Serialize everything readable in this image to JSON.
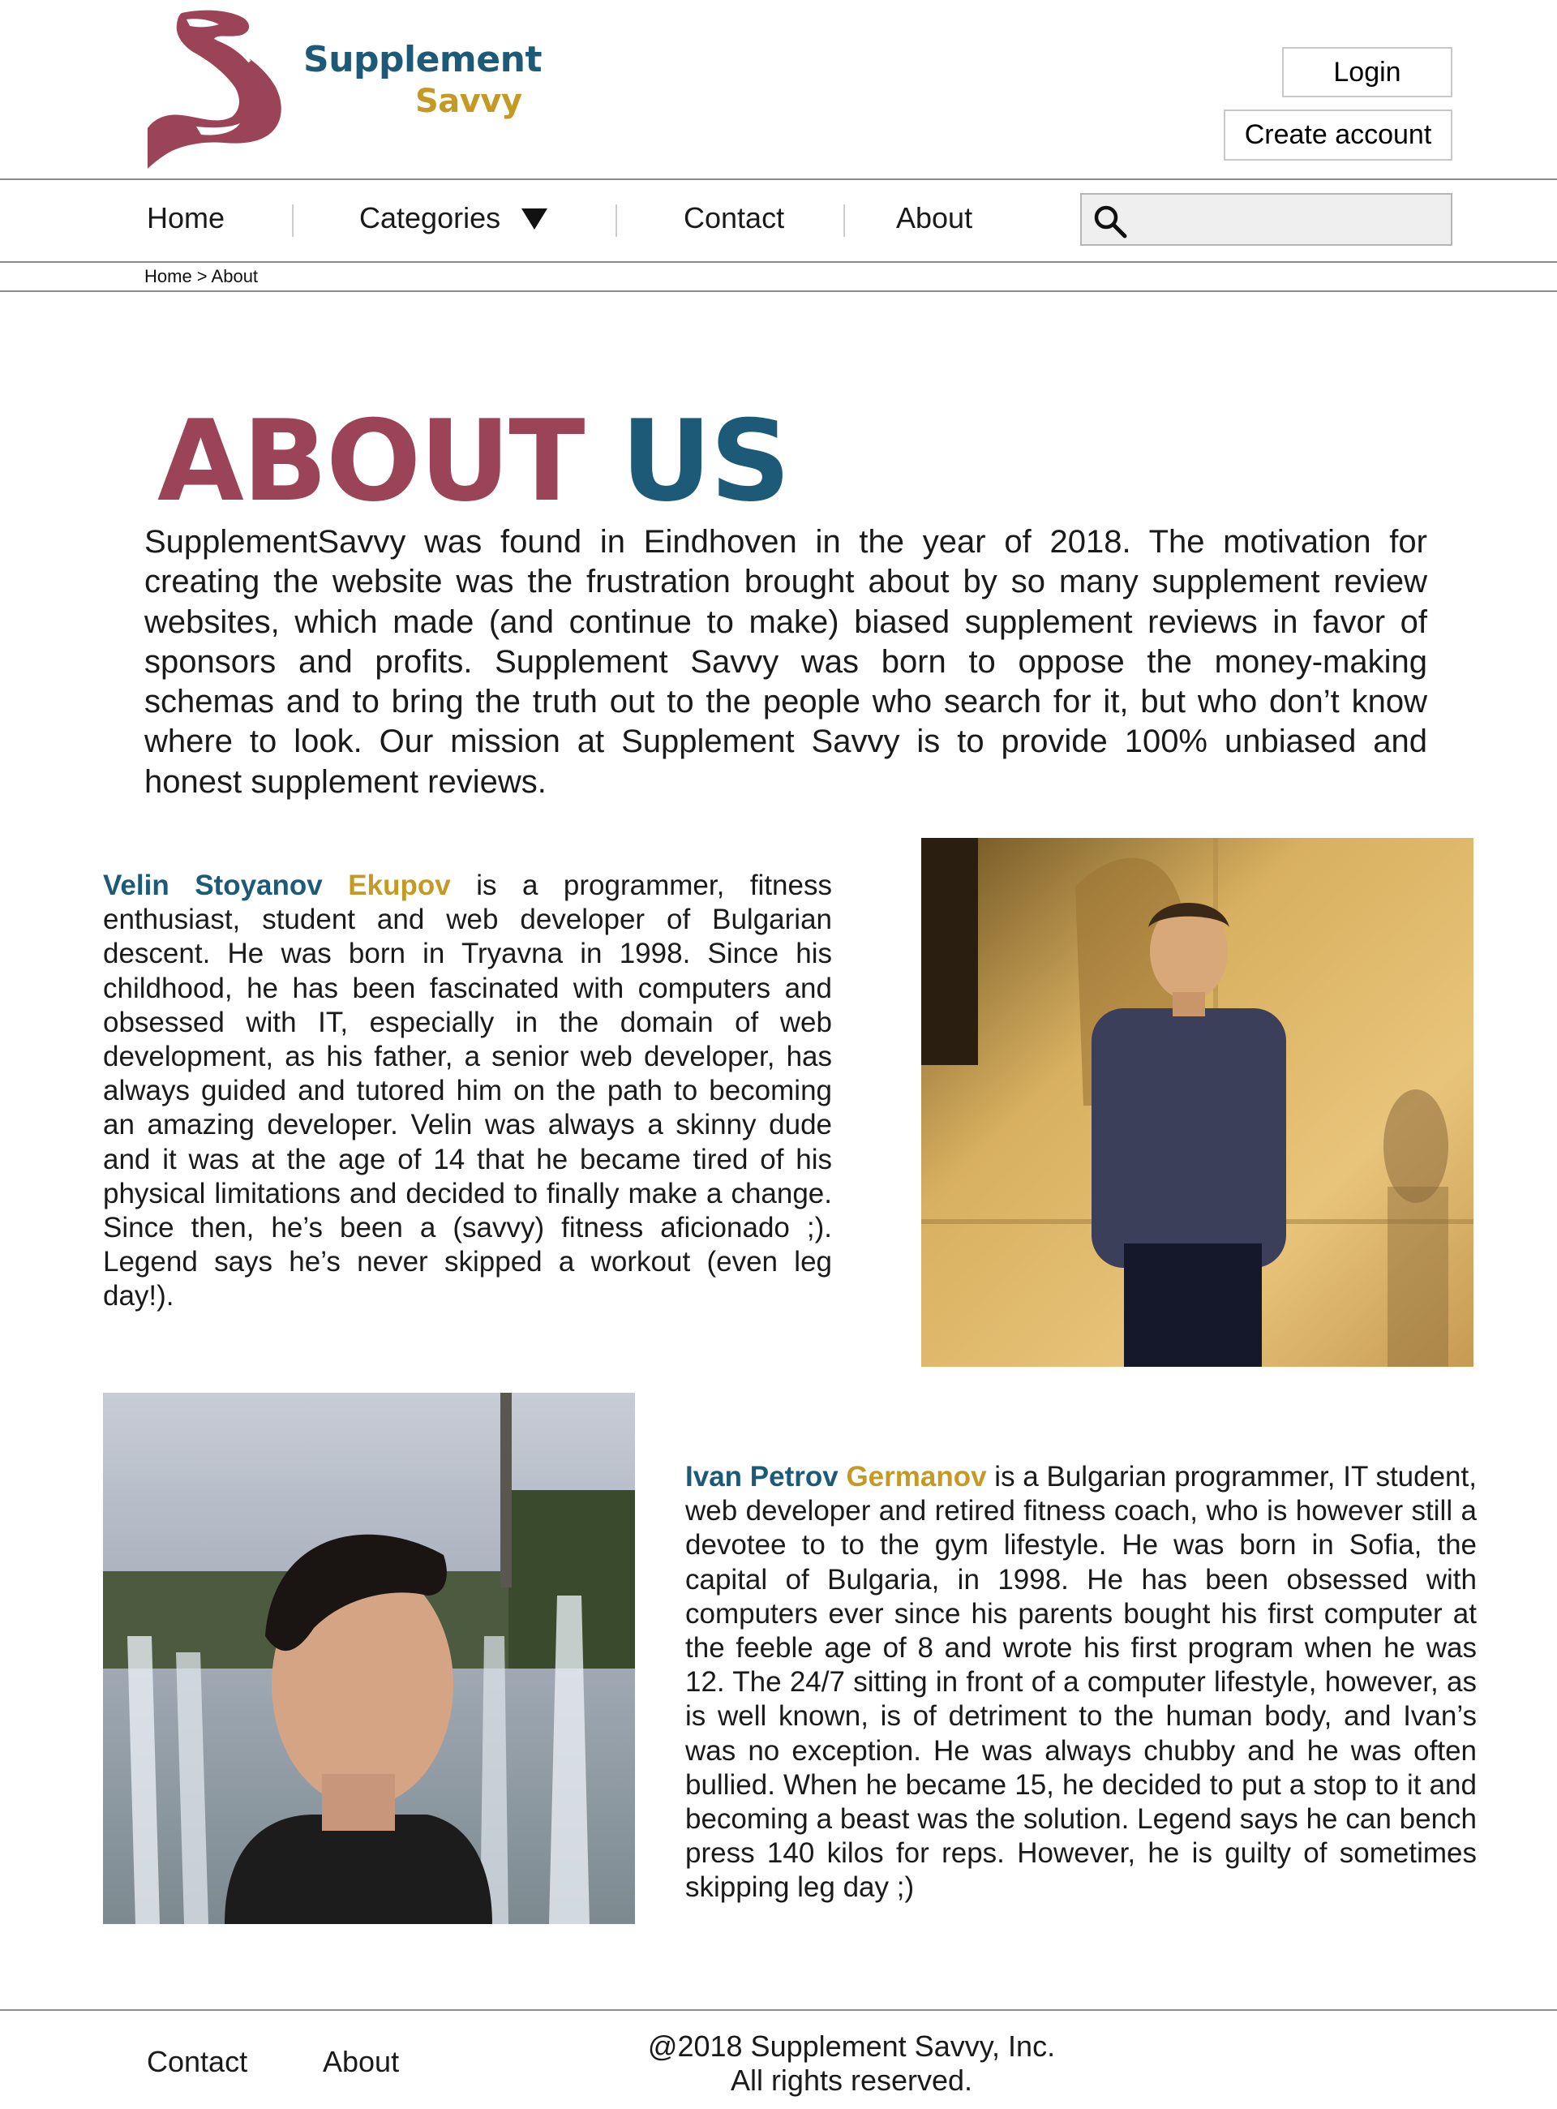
{
  "brand": {
    "line1": "Supplement",
    "line2": "Savvy",
    "colors": {
      "primary": "#1d5a78",
      "accent": "#c49a25",
      "logo": "#9b4457"
    }
  },
  "account": {
    "login_label": "Login",
    "create_label": "Create account"
  },
  "nav": {
    "home": "Home",
    "categories": "Categories",
    "contact": "Contact",
    "about": "About",
    "search_placeholder": ""
  },
  "breadcrumb": "Home > About",
  "about": {
    "title_word1": "ABOUT",
    "title_word2": "US",
    "intro": "SupplementSavvy was found in Eindhoven in the year of 2018. The motivation for creating the website was the frustration brought about by so many supplement review websites, which made (and continue to make) biased supplement reviews in favor of sponsors and profits. Supplement Savvy was born to oppose the money-making schemas and to bring the truth out to the people who search for it, but who don’t know where to look. Our mission at Supplement Savvy is to provide 100% unbiased and honest supplement reviews."
  },
  "team": [
    {
      "first_names": "Velin Stoyanov",
      "last_name": "Ekupov",
      "bio": " is a programmer, fitness enthusiast, student and web developer of Bulgarian descent. He was born in Tryavna in 1998. Since his childhood, he has been fascinated with computers and obsessed with IT, especially in the domain of web development, as his father, a senior web developer, has always guided and tutored him on the path to becoming an amazing developer. Velin was always a skinny dude and it was at the age of 14 that he became tired of his physical limitations and decided to finally make a change. Since then, he’s been a (savvy) fitness aficionado ;). Legend says he’s never skipped a workout (even leg day!)."
    },
    {
      "first_names": "Ivan Petrov",
      "last_name": "Germanov",
      "bio": " is a Bulgarian programmer, IT student, web developer and retired fitness coach, who is however still a devotee to to the gym lifestyle. He was born in Sofia, the capital of Bulgaria, in 1998. He has been obsessed with computers ever since his parents bought his first computer at the feeble age of 8 and wrote his first program when he was 12. The 24/7 sitting in front of a computer lifestyle, however, as is well known, is of detriment to the human body, and Ivan’s was no exception. He was always chubby and he was often bullied. When he became 15, he decided to put a stop to it and becoming a beast was the solution. Legend says he can bench press 140 kilos for reps. However, he is guilty of sometimes skipping leg day ;)"
    }
  ],
  "footer": {
    "contact": "Contact",
    "about": "About",
    "copyright_line1": "@2018 Supplement Savvy, Inc.",
    "copyright_line2": "All rights reserved."
  }
}
